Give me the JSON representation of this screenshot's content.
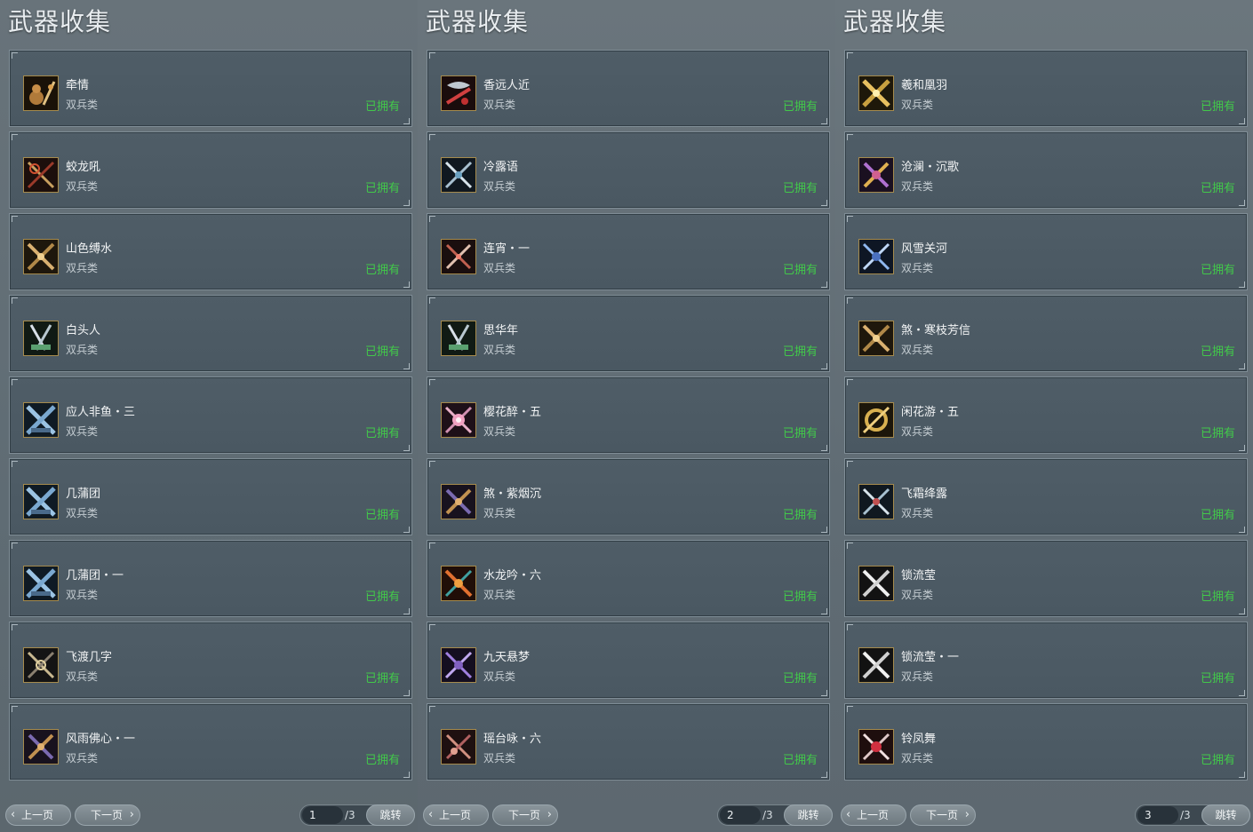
{
  "panels": [
    {
      "title": "武器收集",
      "items": [
        {
          "name": "牵情",
          "type": "双兵类",
          "status": "已拥有",
          "icon": "gourd-weapon-icon"
        },
        {
          "name": "蛟龙吼",
          "type": "双兵类",
          "status": "已拥有",
          "icon": "halberd-weapon-icon"
        },
        {
          "name": "山色缚水",
          "type": "双兵类",
          "status": "已拥有",
          "icon": "gold-sword-weapon-icon"
        },
        {
          "name": "白头人",
          "type": "双兵类",
          "status": "已拥有",
          "icon": "jade-sword-weapon-icon"
        },
        {
          "name": "应人非鱼・三",
          "type": "双兵类",
          "status": "已拥有",
          "icon": "blue-blade-weapon-icon"
        },
        {
          "name": "几蒲团",
          "type": "双兵类",
          "status": "已拥有",
          "icon": "blue-blade-weapon-icon"
        },
        {
          "name": "几蒲团・一",
          "type": "双兵类",
          "status": "已拥有",
          "icon": "blue-blade-weapon-icon"
        },
        {
          "name": "飞渡几字",
          "type": "双兵类",
          "status": "已拥有",
          "icon": "dark-sword-weapon-icon"
        },
        {
          "name": "风雨佛心・一",
          "type": "双兵类",
          "status": "已拥有",
          "icon": "purple-gold-weapon-icon"
        }
      ],
      "footer": {
        "prev": "上一页",
        "next": "下一页",
        "page": "1",
        "total": "/3",
        "jump": "跳转"
      }
    },
    {
      "title": "武器收集",
      "items": [
        {
          "name": "香远人近",
          "type": "双兵类",
          "status": "已拥有",
          "icon": "red-dragon-weapon-icon"
        },
        {
          "name": "冷露语",
          "type": "双兵类",
          "status": "已拥有",
          "icon": "silver-sword-weapon-icon"
        },
        {
          "name": "连宵・一",
          "type": "双兵类",
          "status": "已拥有",
          "icon": "red-sword-weapon-icon"
        },
        {
          "name": "思华年",
          "type": "双兵类",
          "status": "已拥有",
          "icon": "jade-sword-weapon-icon"
        },
        {
          "name": "樱花醉・五",
          "type": "双兵类",
          "status": "已拥有",
          "icon": "pink-blossom-weapon-icon"
        },
        {
          "name": "煞・紫烟沉",
          "type": "双兵类",
          "status": "已拥有",
          "icon": "purple-gold-weapon-icon"
        },
        {
          "name": "水龙吟・六",
          "type": "双兵类",
          "status": "已拥有",
          "icon": "fire-blade-weapon-icon"
        },
        {
          "name": "九天悬梦",
          "type": "双兵类",
          "status": "已拥有",
          "icon": "violet-sword-weapon-icon"
        },
        {
          "name": "瑶台咏・六",
          "type": "双兵类",
          "status": "已拥有",
          "icon": "rose-blade-weapon-icon"
        }
      ],
      "footer": {
        "prev": "上一页",
        "next": "下一页",
        "page": "2",
        "total": "/3",
        "jump": "跳转"
      }
    },
    {
      "title": "武器收集",
      "items": [
        {
          "name": "羲和凰羽",
          "type": "双兵类",
          "status": "已拥有",
          "icon": "gold-feather-weapon-icon"
        },
        {
          "name": "沧澜・沉歌",
          "type": "双兵类",
          "status": "已拥有",
          "icon": "violet-gold-weapon-icon"
        },
        {
          "name": "风雪关河",
          "type": "双兵类",
          "status": "已拥有",
          "icon": "blue-sword-weapon-icon"
        },
        {
          "name": "煞・寒枝芳信",
          "type": "双兵类",
          "status": "已拥有",
          "icon": "gold-sword-weapon-icon"
        },
        {
          "name": "闲花游・五",
          "type": "双兵类",
          "status": "已拥有",
          "icon": "gold-ring-weapon-icon"
        },
        {
          "name": "飞霜绛露",
          "type": "双兵类",
          "status": "已拥有",
          "icon": "silver-sword-weapon-icon"
        },
        {
          "name": "锁流莹",
          "type": "双兵类",
          "status": "已拥有",
          "icon": "white-sword-weapon-icon"
        },
        {
          "name": "锁流莹・一",
          "type": "双兵类",
          "status": "已拥有",
          "icon": "white-sword-weapon-icon"
        },
        {
          "name": "铃凤舞",
          "type": "双兵类",
          "status": "已拥有",
          "icon": "red-flower-weapon-icon"
        }
      ],
      "footer": {
        "prev": "上一页",
        "next": "下一页",
        "page": "3",
        "total": "/3",
        "jump": "跳转"
      }
    }
  ],
  "colors": {
    "owned": "#42c94a",
    "icon_border": "#a68b4d",
    "panel_bg": "#5f6c74",
    "card_bg": "#4c5a64"
  }
}
